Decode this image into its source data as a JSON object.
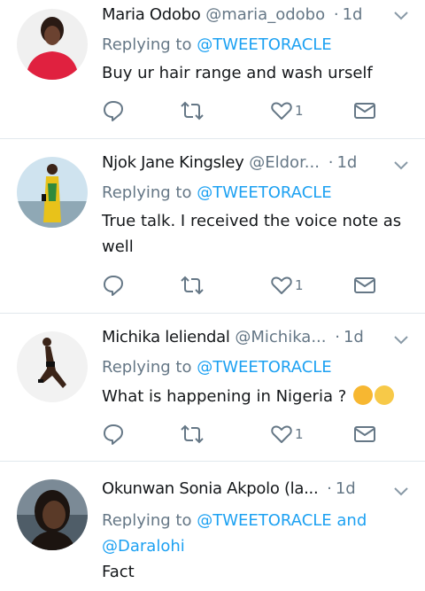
{
  "tweets": [
    {
      "name": "Maria Odobo",
      "handle": "@maria_odobo",
      "time": "1d",
      "replying_label": "Replying to",
      "replying_to": "@TWEETORACLE",
      "text": "Buy ur hair range and wash urself",
      "likes": "1",
      "avatar_colors": [
        "#e0213f",
        "#2a1a14"
      ]
    },
    {
      "name": "Njok Jane Kingsley",
      "handle": "@Eldor...",
      "time": "1d",
      "replying_label": "Replying to",
      "replying_to": "@TWEETORACLE",
      "text": "True talk. I received the voice note as well",
      "likes": "1",
      "avatar_colors": [
        "#cfe3ef",
        "#e8c21a"
      ]
    },
    {
      "name": "Michika leliendal",
      "handle": "@Michika...",
      "time": "1d",
      "replying_label": "Replying to",
      "replying_to": "@TWEETORACLE",
      "text": "What is happening in Nigeria ?",
      "likes": "1",
      "avatar_colors": [
        "#f2f2f2",
        "#3b2418"
      ],
      "emojis": [
        "thinking-face-emoji",
        "unamused-face-emoji"
      ]
    },
    {
      "name": "Okunwan Sonia Akpolo  (la...",
      "handle": "",
      "time": "1d",
      "replying_label": "Replying to",
      "replying_to": "@TWEETORACLE",
      "replying_and": "and",
      "replying_to_2": "@Daralohi",
      "text": "Fact",
      "avatar_colors": [
        "#7b8a96",
        "#1c1410"
      ]
    }
  ],
  "colors": {
    "accent": "#1da1f2",
    "muted": "#657786",
    "text": "#14171a",
    "divider": "#e1e8ed"
  }
}
